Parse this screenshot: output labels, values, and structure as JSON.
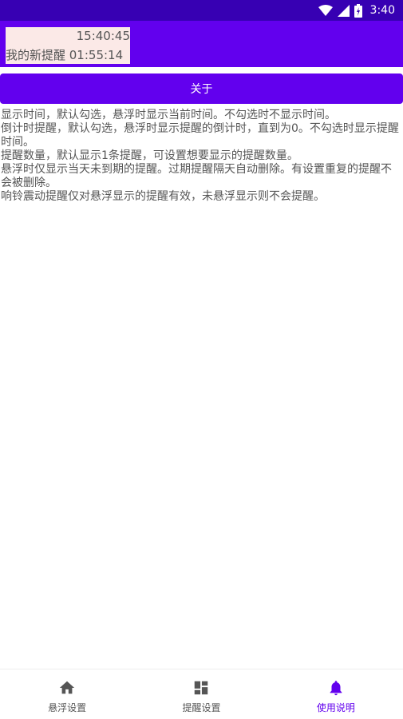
{
  "status_bar": {
    "time": "3:40",
    "icons": [
      "wifi-icon",
      "cell-signal-icon",
      "battery-charging-icon"
    ]
  },
  "float_preview": {
    "current_time": "15:40:45",
    "reminder_text": "我的新提醒  01:55:14"
  },
  "about_button": {
    "label": "关于"
  },
  "instructions": [
    "显示时间，默认勾选，悬浮时显示当前时间。不勾选时不显示时间。",
    "倒计时提醒，默认勾选，悬浮时显示提醒的倒计时，直到为0。不勾选时显示提醒时间。",
    "提醒数量，默认显示1条提醒，可设置想要显示的提醒数量。",
    "悬浮时仅显示当天未到期的提醒。过期提醒隔天自动删除。有设置重复的提醒不会被删除。",
    "响铃震动提醒仅对悬浮显示的提醒有效，未悬浮显示则不会提醒。"
  ],
  "bottom_nav": {
    "items": [
      {
        "label": "悬浮设置",
        "icon": "home-icon",
        "active": false
      },
      {
        "label": "提醒设置",
        "icon": "dashboard-icon",
        "active": false
      },
      {
        "label": "使用说明",
        "icon": "bell-icon",
        "active": true
      }
    ]
  },
  "colors": {
    "status_bar": "#3700b3",
    "primary": "#6200ee",
    "float_background": "#fbe9e7",
    "text": "#555555",
    "nav_inactive": "#555555"
  }
}
